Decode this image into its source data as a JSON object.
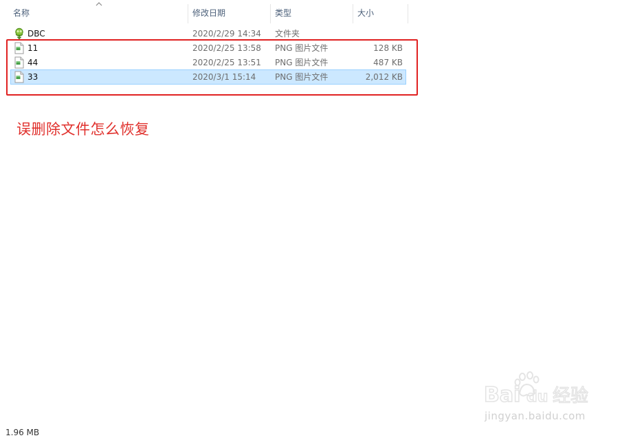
{
  "columns": {
    "name": "名称",
    "modified": "修改日期",
    "type": "类型",
    "size": "大小"
  },
  "files": [
    {
      "name": "DBC",
      "modified": "2020/2/29 14:34",
      "type": "文件夹",
      "size": "",
      "icon": "folder-recycle-icon",
      "selected": false
    },
    {
      "name": "11",
      "modified": "2020/2/25 13:58",
      "type": "PNG 图片文件",
      "size": "128 KB",
      "icon": "png-file-icon",
      "selected": false
    },
    {
      "name": "44",
      "modified": "2020/2/25 13:51",
      "type": "PNG 图片文件",
      "size": "487 KB",
      "icon": "png-file-icon",
      "selected": false
    },
    {
      "name": "33",
      "modified": "2020/3/1 15:14",
      "type": "PNG 图片文件",
      "size": "2,012 KB",
      "icon": "png-file-icon",
      "selected": true
    }
  ],
  "annotation": "误删除文件怎么恢复",
  "status": {
    "selection_size": "1.96 MB"
  },
  "watermark": {
    "brand": "Baidu经验",
    "url": "jingyan.baidu.com"
  },
  "colors": {
    "annotation_red": "#e02020",
    "selection_bg": "#cce8ff",
    "header_text": "#4c607a"
  }
}
